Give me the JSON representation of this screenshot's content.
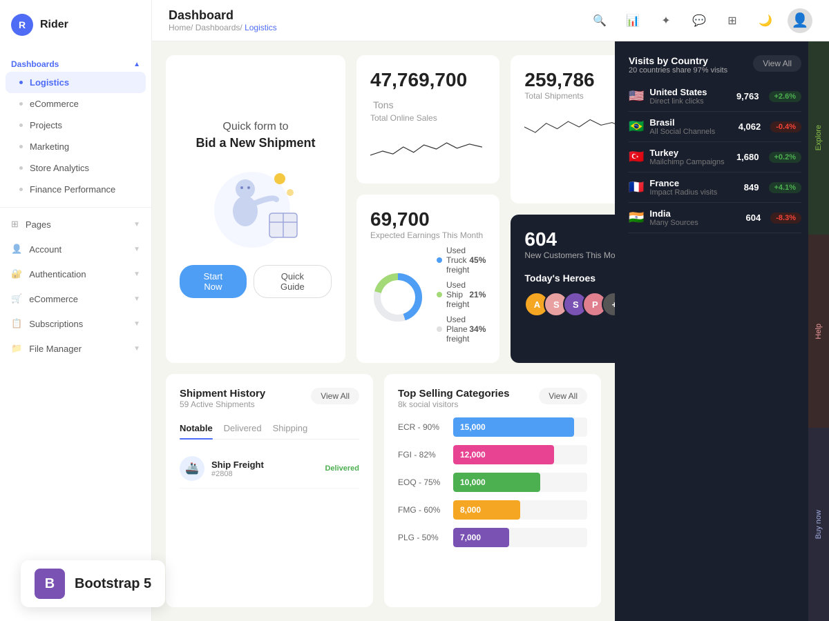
{
  "app": {
    "name": "Rider",
    "logo_letter": "R"
  },
  "sidebar": {
    "dashboards_label": "Dashboards",
    "items": [
      {
        "id": "logistics",
        "label": "Logistics",
        "active": true
      },
      {
        "id": "ecommerce",
        "label": "eCommerce",
        "active": false
      },
      {
        "id": "projects",
        "label": "Projects",
        "active": false
      },
      {
        "id": "marketing",
        "label": "Marketing",
        "active": false
      },
      {
        "id": "store-analytics",
        "label": "Store Analytics",
        "active": false
      },
      {
        "id": "finance-performance",
        "label": "Finance Performance",
        "active": false
      }
    ],
    "main_items": [
      {
        "id": "pages",
        "label": "Pages",
        "icon": "⊞"
      },
      {
        "id": "account",
        "label": "Account",
        "icon": "👤"
      },
      {
        "id": "authentication",
        "label": "Authentication",
        "icon": "🔐"
      },
      {
        "id": "ecommerce-main",
        "label": "eCommerce",
        "icon": "🛒"
      },
      {
        "id": "subscriptions",
        "label": "Subscriptions",
        "icon": "📋"
      },
      {
        "id": "file-manager",
        "label": "File Manager",
        "icon": "📁"
      }
    ]
  },
  "header": {
    "title": "Dashboard",
    "breadcrumb_home": "Home/",
    "breadcrumb_dashboards": "Dashboards/",
    "breadcrumb_current": "Logistics"
  },
  "quick_form": {
    "title": "Quick form to",
    "subtitle": "Bid a New Shipment",
    "btn_start": "Start Now",
    "btn_guide": "Quick Guide"
  },
  "stats": {
    "total_online_sales_value": "47,769,700",
    "total_online_sales_unit": "Tons",
    "total_online_sales_label": "Total Online Sales",
    "total_shipments_value": "259,786",
    "total_shipments_label": "Total Shipments",
    "expected_earnings_value": "69,700",
    "expected_earnings_label": "Expected Earnings This Month",
    "new_customers_value": "604",
    "new_customers_label": "New Customers This Month"
  },
  "freight": {
    "truck_label": "Used Truck freight",
    "truck_pct": "45%",
    "truck_value": 45,
    "ship_label": "Used Ship freight",
    "ship_pct": "21%",
    "ship_value": 21,
    "plane_label": "Used Plane freight",
    "plane_pct": "34%",
    "plane_value": 34,
    "truck_color": "#4e9ef5",
    "ship_color": "#a3d977",
    "plane_color": "#e0e0e0"
  },
  "heroes": {
    "title": "Today's Heroes",
    "avatars": [
      {
        "color": "#f5a623",
        "letter": "A"
      },
      {
        "color": "#e8a0a0",
        "letter": "S"
      },
      {
        "color": "#7952b3",
        "letter": "S"
      },
      {
        "color": "#e0808f",
        "letter": "P"
      },
      {
        "color": "#d0d0d0",
        "letter": "+"
      }
    ]
  },
  "shipment_history": {
    "title": "Shipment History",
    "subtitle": "59 Active Shipments",
    "view_all": "View All",
    "tabs": [
      "Notable",
      "Delivered",
      "Shipping"
    ],
    "active_tab": "Notable",
    "items": [
      {
        "icon": "🚢",
        "name": "Ship Freight",
        "id": "2808",
        "status": "Delivered"
      }
    ]
  },
  "top_categories": {
    "title": "Top Selling Categories",
    "subtitle": "8k social visitors",
    "view_all": "View All",
    "bars": [
      {
        "label": "ECR - 90%",
        "value": 15000,
        "display": "15,000",
        "color": "#4e9ef5",
        "width": "90%"
      },
      {
        "label": "FGI - 82%",
        "value": 12000,
        "display": "12,000",
        "color": "#e84393",
        "width": "75%"
      },
      {
        "label": "EOQ - 75%",
        "value": 10000,
        "display": "10,000",
        "color": "#4caf50",
        "width": "65%"
      },
      {
        "label": "FMG - 60%",
        "value": 8000,
        "display": "8,000",
        "color": "#f5a623",
        "width": "50%"
      },
      {
        "label": "PLG - 50%",
        "value": 7000,
        "display": "7,000",
        "color": "#7952b3",
        "width": "42%"
      }
    ]
  },
  "visits_by_country": {
    "title": "Visits by Country",
    "subtitle": "20 countries share 97% visits",
    "view_all": "View All",
    "countries": [
      {
        "flag": "🇺🇸",
        "name": "United States",
        "sub": "Direct link clicks",
        "value": "9,763",
        "change": "+2.6%",
        "up": true
      },
      {
        "flag": "🇧🇷",
        "name": "Brasil",
        "sub": "All Social Channels",
        "value": "4,062",
        "change": "-0.4%",
        "up": false
      },
      {
        "flag": "🇹🇷",
        "name": "Turkey",
        "sub": "Mailchimp Campaigns",
        "value": "1,680",
        "change": "+0.2%",
        "up": true
      },
      {
        "flag": "🇫🇷",
        "name": "France",
        "sub": "Impact Radius visits",
        "value": "849",
        "change": "+4.1%",
        "up": true
      },
      {
        "flag": "🇮🇳",
        "name": "India",
        "sub": "Many Sources",
        "value": "604",
        "change": "-8.3%",
        "up": false
      }
    ]
  },
  "bootstrap": {
    "letter": "B",
    "text": "Bootstrap 5"
  }
}
